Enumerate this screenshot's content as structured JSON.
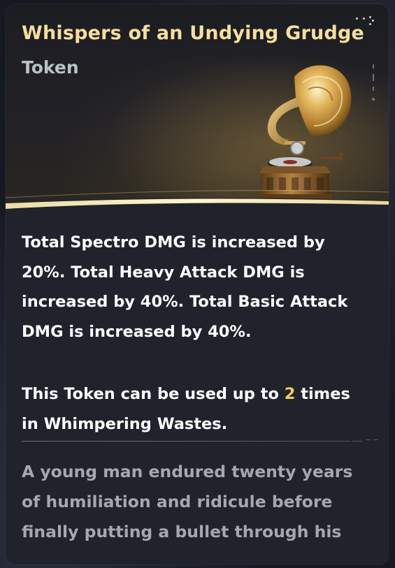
{
  "item": {
    "name": "Whispers of an Undying Grudge",
    "category": "Token"
  },
  "effect": {
    "lines": [
      "Total Spectro DMG is increased by",
      "20%. Total Heavy Attack DMG is",
      "increased by 40%. Total Basic Attack",
      "DMG is increased by 40%."
    ]
  },
  "usage": {
    "prefix": "This Token can be used up to",
    "count": "2",
    "suffix": "times",
    "line2": "in Whimpering Wastes."
  },
  "lore": {
    "lines": [
      "A young man endured twenty years",
      "of humiliation and ridicule before",
      "finally putting a bullet through his"
    ]
  },
  "icons": {
    "item_art": "gramophone-icon",
    "menu": "more-options-icon"
  },
  "colors": {
    "title": "#f5df9c",
    "highlight": "#f1cf55",
    "body_text": "#ffffff",
    "lore_text": "#a6a8ad",
    "card_bg": "#20232c"
  }
}
